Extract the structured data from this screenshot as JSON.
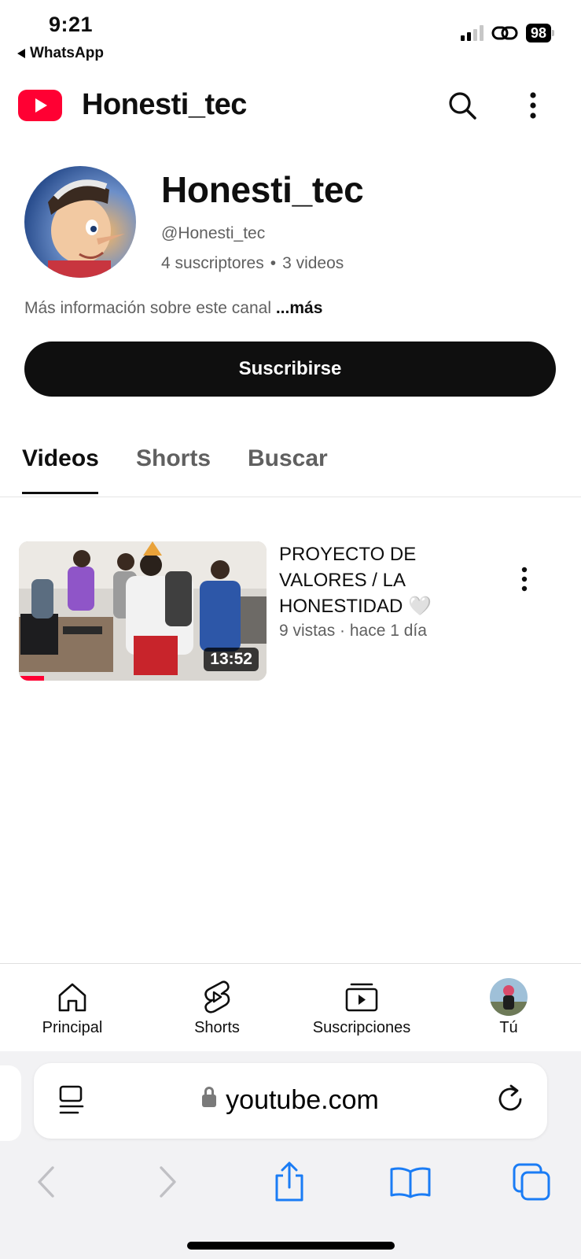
{
  "status_bar": {
    "time": "9:21",
    "back_app": "WhatsApp",
    "battery": "98"
  },
  "header": {
    "title": "Honesti_tec",
    "brand_color": "#ff0033"
  },
  "channel": {
    "name": "Honesti_tec",
    "handle": "@Honesti_tec",
    "subscribers": "4 suscriptores",
    "separator": "•",
    "videos_count": "3 videos",
    "description": "Más información sobre este canal",
    "more_label": "...más",
    "subscribe_label": "Suscribirse"
  },
  "tabs": [
    {
      "label": "Videos",
      "active": true
    },
    {
      "label": "Shorts",
      "active": false
    },
    {
      "label": "Buscar",
      "active": false
    }
  ],
  "videos": [
    {
      "title": "PROYECTO DE VALORES / LA HONESTIDAD 🤍",
      "meta": "9 vistas · hace 1 día",
      "duration": "13:52",
      "watched_fraction": 0.1
    }
  ],
  "bottom_nav": [
    {
      "label": "Principal",
      "icon": "home-icon"
    },
    {
      "label": "Shorts",
      "icon": "shorts-icon"
    },
    {
      "label": "Suscripciones",
      "icon": "subscriptions-icon"
    },
    {
      "label": "Tú",
      "icon": "avatar"
    }
  ],
  "browser": {
    "url": "youtube.com"
  }
}
